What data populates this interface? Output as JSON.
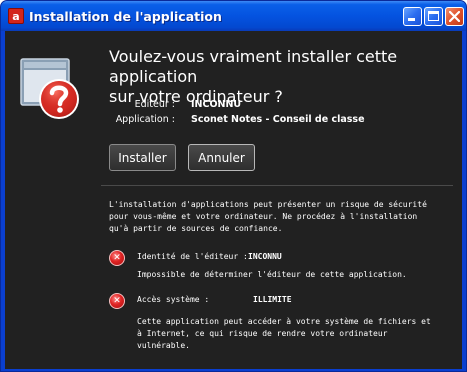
{
  "window": {
    "title": "Installation de l'application",
    "title_icon_glyph": "a",
    "controls": [
      "minimize-icon",
      "maximize-icon",
      "close-icon"
    ]
  },
  "dialog": {
    "heading_line1": "Voulez-vous vraiment installer cette application",
    "heading_line2": "sur votre ordinateur ?",
    "app_icon": "question-mark-window-icon",
    "publisher_label": "Editeur :",
    "publisher_value": "INCONNU",
    "application_label": "Application :",
    "application_value": "Sconet Notes - Conseil de classe",
    "install_label": "Installer",
    "cancel_label": "Annuler",
    "warning_line1": "L'installation d'applications peut présenter un risque de sécurité",
    "warning_line2": "pour vous-même et votre ordinateur. Ne procédez à l'installation",
    "warning_line3": "qu'à partir de sources de confiance.",
    "risks": [
      {
        "icon": "error-x-icon",
        "label": "Identité de l'éditeur :",
        "value": "INCONNU",
        "desc_lines": [
          "Impossible de déterminer l'éditeur de cette application."
        ]
      },
      {
        "icon": "error-x-icon",
        "label": "Accès système :",
        "value": "ILLIMITE",
        "desc_lines": [
          "Cette application peut accéder à votre système de fichiers et",
          "à Internet, ce qui risque de rendre votre ordinateur",
          "vulnérable."
        ]
      }
    ]
  },
  "colors": {
    "titlebar": "#0453e0",
    "content_bg": "#212121",
    "text": "#ffffff",
    "risk_red": "#e02424",
    "question_red": "#d42a22"
  }
}
